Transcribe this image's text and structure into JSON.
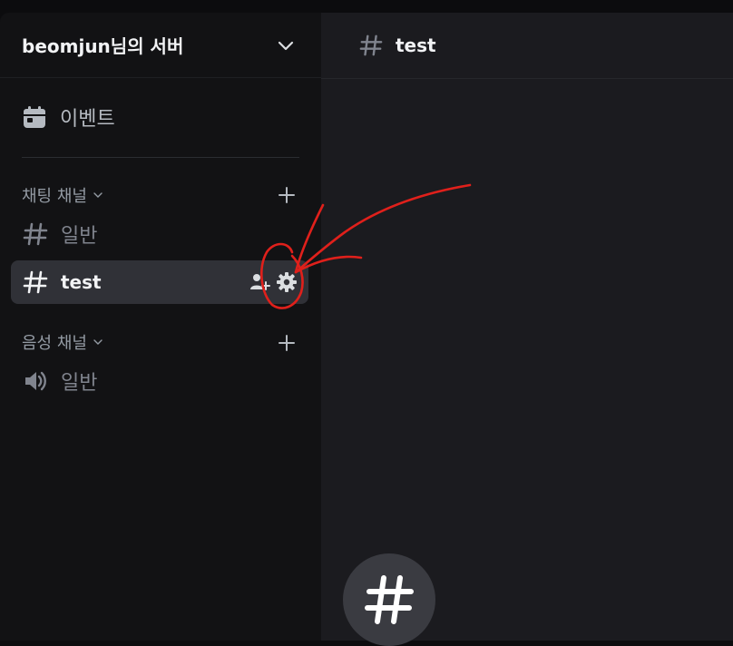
{
  "server": {
    "name": "beomjun님의 서버"
  },
  "sidebar": {
    "events_label": "이벤트",
    "categories": [
      {
        "label": "채팅 채널",
        "channels": [
          {
            "name": "일반",
            "type": "text",
            "active": false
          },
          {
            "name": "test",
            "type": "text",
            "active": true
          }
        ]
      },
      {
        "label": "음성 채널",
        "channels": [
          {
            "name": "일반",
            "type": "voice",
            "active": false
          }
        ]
      }
    ]
  },
  "main": {
    "channel_title": "test"
  },
  "icons": {
    "events": "calendar-icon",
    "text_channel": "hashtag-icon",
    "voice_channel": "speaker-icon",
    "invite": "add-member-icon",
    "settings": "gear-icon",
    "create": "plus-icon",
    "collapse": "chevron-down-icon"
  },
  "colors": {
    "sidebar_bg": "#121214",
    "main_bg": "#1b1b1f",
    "active_channel_bg": "#303137",
    "annotation_red": "#e0201b"
  }
}
